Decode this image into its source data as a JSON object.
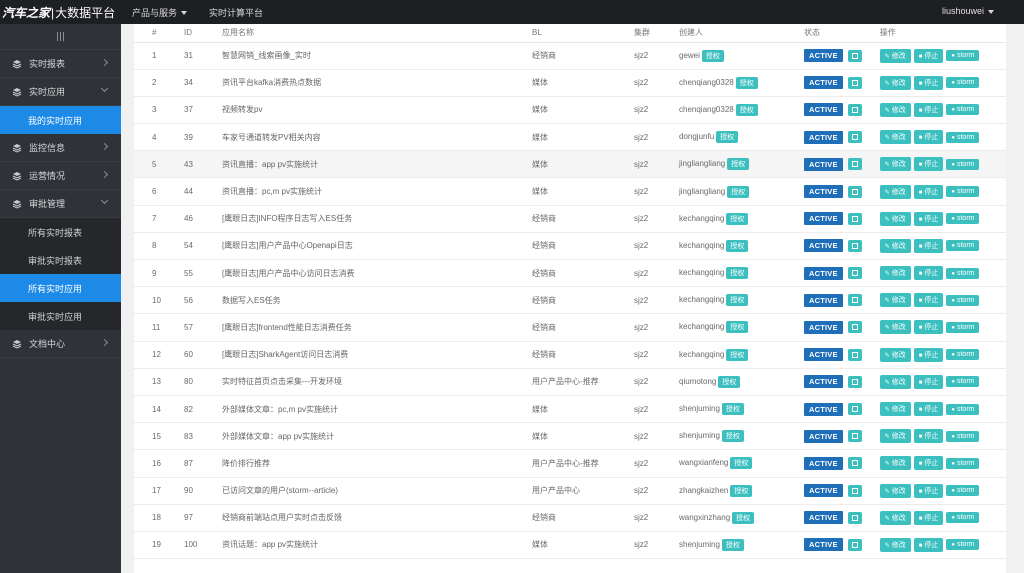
{
  "header": {
    "logo_text": "汽车之家",
    "separator": "|",
    "platform_name": "大数据平台",
    "nav": [
      {
        "label": "产品与服务",
        "has_dropdown": true
      },
      {
        "label": "实时计算平台",
        "has_dropdown": false
      }
    ],
    "user": "liushouwei"
  },
  "sidebar": {
    "items": [
      {
        "label": "实时报表",
        "icon": "layers-icon",
        "arrow": "right"
      },
      {
        "label": "实时应用",
        "icon": "layers-icon",
        "arrow": "down",
        "children": [
          {
            "label": "我的实时应用",
            "active": true
          }
        ]
      },
      {
        "label": "监控信息",
        "icon": "layers-icon",
        "arrow": "right"
      },
      {
        "label": "运营情况",
        "icon": "layers-icon",
        "arrow": "right"
      },
      {
        "label": "审批管理",
        "icon": "layers-icon",
        "arrow": "down",
        "children": [
          {
            "label": "所有实时报表",
            "active": false
          },
          {
            "label": "审批实时报表",
            "active": false
          },
          {
            "label": "所有实时应用",
            "active": true
          },
          {
            "label": "审批实时应用",
            "active": false
          }
        ]
      },
      {
        "label": "文档中心",
        "icon": "layers-icon",
        "arrow": "right"
      }
    ]
  },
  "table": {
    "headers": [
      "#",
      "ID",
      "应用名称",
      "BL",
      "集群",
      "创建人",
      "状态",
      "操作"
    ],
    "auth_label": "授权",
    "status_label": "ACTIVE",
    "ops": [
      "修改",
      "停止",
      "storm"
    ],
    "rows": [
      {
        "idx": "1",
        "id": "31",
        "name": "智慧网销_线索画像_实时",
        "bl": "经销商",
        "cluster": "sjz2",
        "creator": "gewei"
      },
      {
        "idx": "2",
        "id": "34",
        "name": "资讯平台kafka消费热点数据",
        "bl": "媒体",
        "cluster": "sjz2",
        "creator": "chenqiang0328"
      },
      {
        "idx": "3",
        "id": "37",
        "name": "视频转发pv",
        "bl": "媒体",
        "cluster": "sjz2",
        "creator": "chenqiang0328"
      },
      {
        "idx": "4",
        "id": "39",
        "name": "车家号通道转发PV相关内容",
        "bl": "媒体",
        "cluster": "sjz2",
        "creator": "dongjunfu"
      },
      {
        "idx": "5",
        "id": "43",
        "name": "资讯直播：app pv实施统计",
        "bl": "媒体",
        "cluster": "sjz2",
        "creator": "jingliangliang"
      },
      {
        "idx": "6",
        "id": "44",
        "name": "资讯直播：pc,m pv实施统计",
        "bl": "媒体",
        "cluster": "sjz2",
        "creator": "jingliangliang"
      },
      {
        "idx": "7",
        "id": "46",
        "name": "[鹰眼日志]INFO程序日志写入ES任务",
        "bl": "经销商",
        "cluster": "sjz2",
        "creator": "kechangqing"
      },
      {
        "idx": "8",
        "id": "54",
        "name": "[鹰眼日志]用户产品中心Openapi日志",
        "bl": "经销商",
        "cluster": "sjz2",
        "creator": "kechangqing"
      },
      {
        "idx": "9",
        "id": "55",
        "name": "[鹰眼日志]用户产品中心访问日志消费",
        "bl": "经销商",
        "cluster": "sjz2",
        "creator": "kechangqing"
      },
      {
        "idx": "10",
        "id": "56",
        "name": "数据写入ES任务",
        "bl": "经销商",
        "cluster": "sjz2",
        "creator": "kechangqing"
      },
      {
        "idx": "11",
        "id": "57",
        "name": "[鹰眼日志]frontend性能日志消费任务",
        "bl": "经销商",
        "cluster": "sjz2",
        "creator": "kechangqing"
      },
      {
        "idx": "12",
        "id": "60",
        "name": "[鹰眼日志]SharkAgent访问日志消费",
        "bl": "经销商",
        "cluster": "sjz2",
        "creator": "kechangqing"
      },
      {
        "idx": "13",
        "id": "80",
        "name": "实时特征首页点击采集---开发环境",
        "bl": "用户产品中心-推荐",
        "cluster": "sjz2",
        "creator": "qiumotong"
      },
      {
        "idx": "14",
        "id": "82",
        "name": "外部媒体文章：pc,m pv实施统计",
        "bl": "媒体",
        "cluster": "sjz2",
        "creator": "shenjuming"
      },
      {
        "idx": "15",
        "id": "83",
        "name": "外部媒体文章：app pv实施统计",
        "bl": "媒体",
        "cluster": "sjz2",
        "creator": "shenjuming"
      },
      {
        "idx": "16",
        "id": "87",
        "name": "降价排行推荐",
        "bl": "用户产品中心-推荐",
        "cluster": "sjz2",
        "creator": "wangxianfeng"
      },
      {
        "idx": "17",
        "id": "90",
        "name": "已访问文章的用户(storm--article)",
        "bl": "用户产品中心",
        "cluster": "sjz2",
        "creator": "zhangkaizhen"
      },
      {
        "idx": "18",
        "id": "97",
        "name": "经销商前端站点用户实时点击反馈",
        "bl": "经销商",
        "cluster": "sjz2",
        "creator": "wangxinzhang"
      },
      {
        "idx": "19",
        "id": "100",
        "name": "资讯话题：app pv实施统计",
        "bl": "媒体",
        "cluster": "sjz2",
        "creator": "shenjuming"
      }
    ]
  }
}
